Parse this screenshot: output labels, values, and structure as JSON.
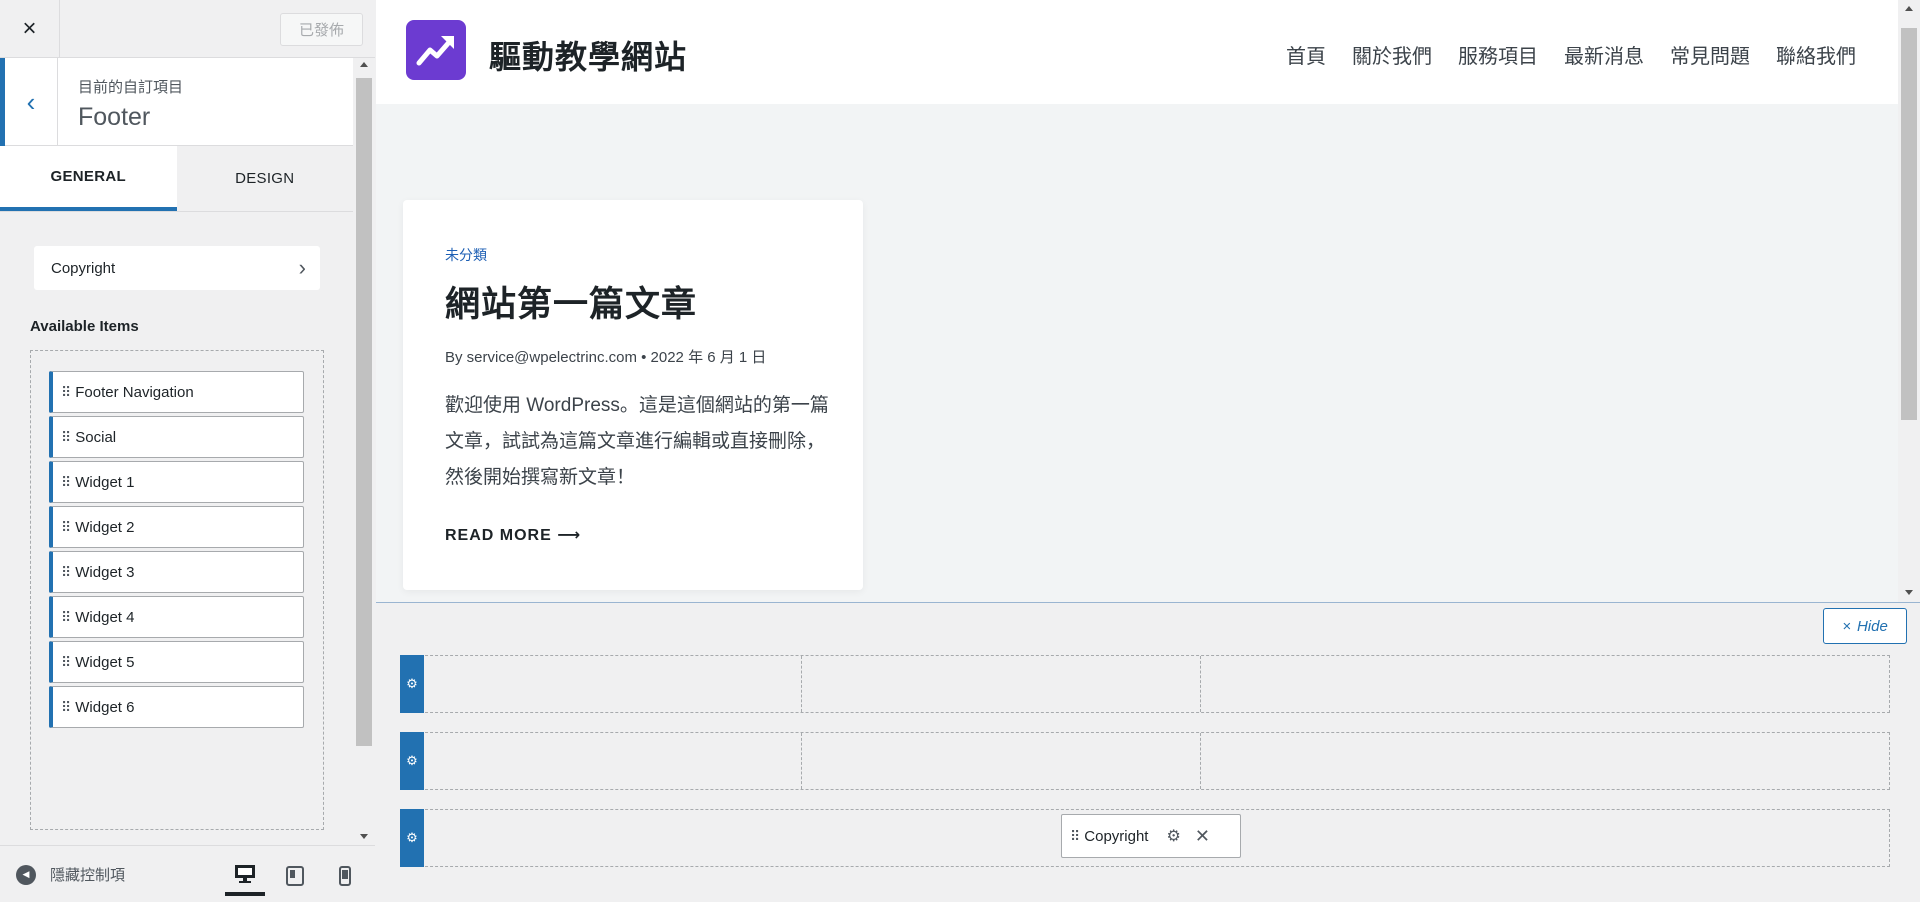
{
  "panel": {
    "close_icon": "×",
    "publish_label": "已發佈",
    "section_sub": "目前的自訂項目",
    "section_title": "Footer",
    "back_icon": "‹",
    "tabs": [
      {
        "label": "GENERAL",
        "active": true
      },
      {
        "label": "DESIGN",
        "active": false
      }
    ],
    "copyright_label": "Copyright",
    "chevron": "›",
    "available_title": "Available Items",
    "available_items": [
      "Footer Navigation",
      "Social",
      "Widget 1",
      "Widget 2",
      "Widget 3",
      "Widget 4",
      "Widget 5",
      "Widget 6"
    ],
    "hide_controls_label": "隱藏控制項",
    "devices": [
      "desktop",
      "tablet",
      "mobile"
    ],
    "active_device": "desktop"
  },
  "site": {
    "title": "驅動教學網站",
    "nav": [
      "首頁",
      "關於我們",
      "服務項目",
      "最新消息",
      "常見問題",
      "聯絡我們"
    ]
  },
  "post": {
    "category": "未分類",
    "title": "網站第一篇文章",
    "meta": "By service@wpelectrinc.com  •  2022 年 6 月 1 日",
    "excerpt": "歡迎使用 WordPress。這是這個網站的第一篇文章，試試為這篇文章進行編輯或直接刪除，然後開始撰寫新文章！",
    "read_more": "READ MORE ⟶"
  },
  "builder": {
    "hide_label": "Hide",
    "hide_icon": "×",
    "copyright_label": "Copyright"
  },
  "colors": {
    "accent": "#2271b1",
    "logo": "#6c3bd1"
  }
}
